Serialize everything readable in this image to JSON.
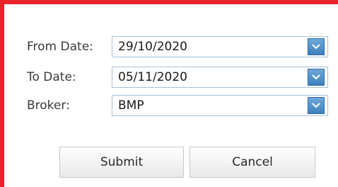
{
  "form": {
    "from_date": {
      "label": "From Date:",
      "value": "29/10/2020"
    },
    "to_date": {
      "label": "To Date:",
      "value": "05/11/2020"
    },
    "broker": {
      "label": "Broker:",
      "value": "BMP"
    }
  },
  "buttons": {
    "submit_label": "Submit",
    "cancel_label": "Cancel"
  },
  "colors": {
    "frame_border": "#e8232a",
    "dropdown_button": "#4a8cc9"
  }
}
